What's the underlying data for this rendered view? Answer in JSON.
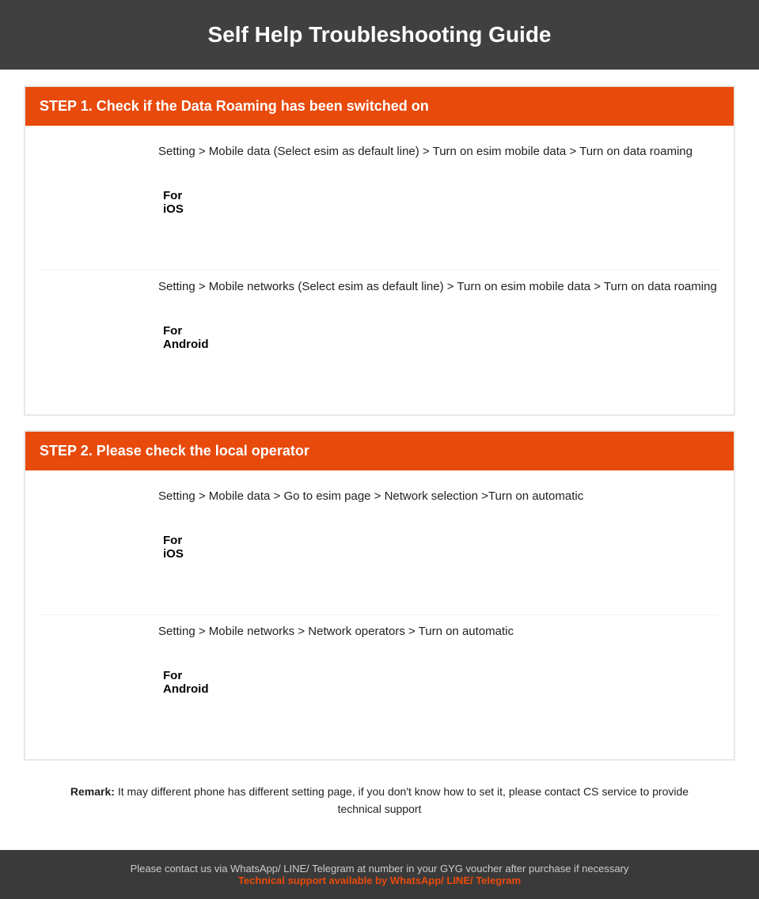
{
  "header": {
    "title": "Self Help Troubleshooting Guide"
  },
  "step1": {
    "heading": "STEP 1.  Check if the Data Roaming has been switched on",
    "ios_label": "For iOS",
    "ios_description": "Setting > Mobile data (Select esim as default line) > Turn on esim mobile data > Turn on data roaming",
    "android_label": "For Android",
    "android_description": "Setting > Mobile networks (Select esim as default line) > Turn on esim mobile data > Turn on data roaming"
  },
  "step2": {
    "heading": "STEP 2.  Please check the local operator",
    "ios_label": "For iOS",
    "ios_description": "Setting > Mobile data > Go to esim page > Network selection >Turn on automatic",
    "android_label": "For Android",
    "android_description": "Setting > Mobile networks > Network operators > Turn on automatic"
  },
  "remark": {
    "prefix": "Remark:",
    "text": " It may different phone has different setting page, if you don't know how to set it,  please contact CS service to provide technical support"
  },
  "footer": {
    "main_text": "Please contact us via WhatsApp/ LINE/ Telegram at number in your GYG voucher after purchase if necessary",
    "support_text": "Technical support available by WhatsApp/ LINE/ Telegram"
  }
}
